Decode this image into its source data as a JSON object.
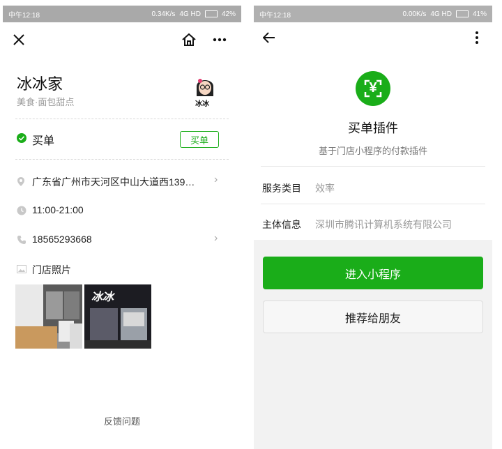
{
  "left": {
    "status": {
      "time": "中午12:18",
      "net": "0.34K/s",
      "signal": "4G HD",
      "battery": "42%"
    },
    "store": {
      "name": "冰冰家",
      "category": "美食·面包甜点",
      "avatar_text": "冰冰"
    },
    "pay": {
      "label": "买单",
      "button": "买单"
    },
    "address": "广东省广州市天河区中山大道西139…",
    "hours": "11:00-21:00",
    "phone": "18565293668",
    "photos_label": "门店照片",
    "photo2_sign": "冰冰",
    "feedback": "反馈问题"
  },
  "right": {
    "status": {
      "time": "中午12:18",
      "net": "0.00K/s",
      "signal": "4G HD",
      "battery": "41%"
    },
    "logo_symbol": "¥",
    "title": "买单插件",
    "subtitle": "基于门店小程序的付款插件",
    "rows": [
      {
        "label": "服务类目",
        "value": "效率"
      },
      {
        "label": "主体信息",
        "value": "深圳市腾讯计算机系统有限公司"
      }
    ],
    "enter_button": "进入小程序",
    "recommend_button": "推荐给朋友"
  },
  "colors": {
    "accent": "#1aad19"
  }
}
